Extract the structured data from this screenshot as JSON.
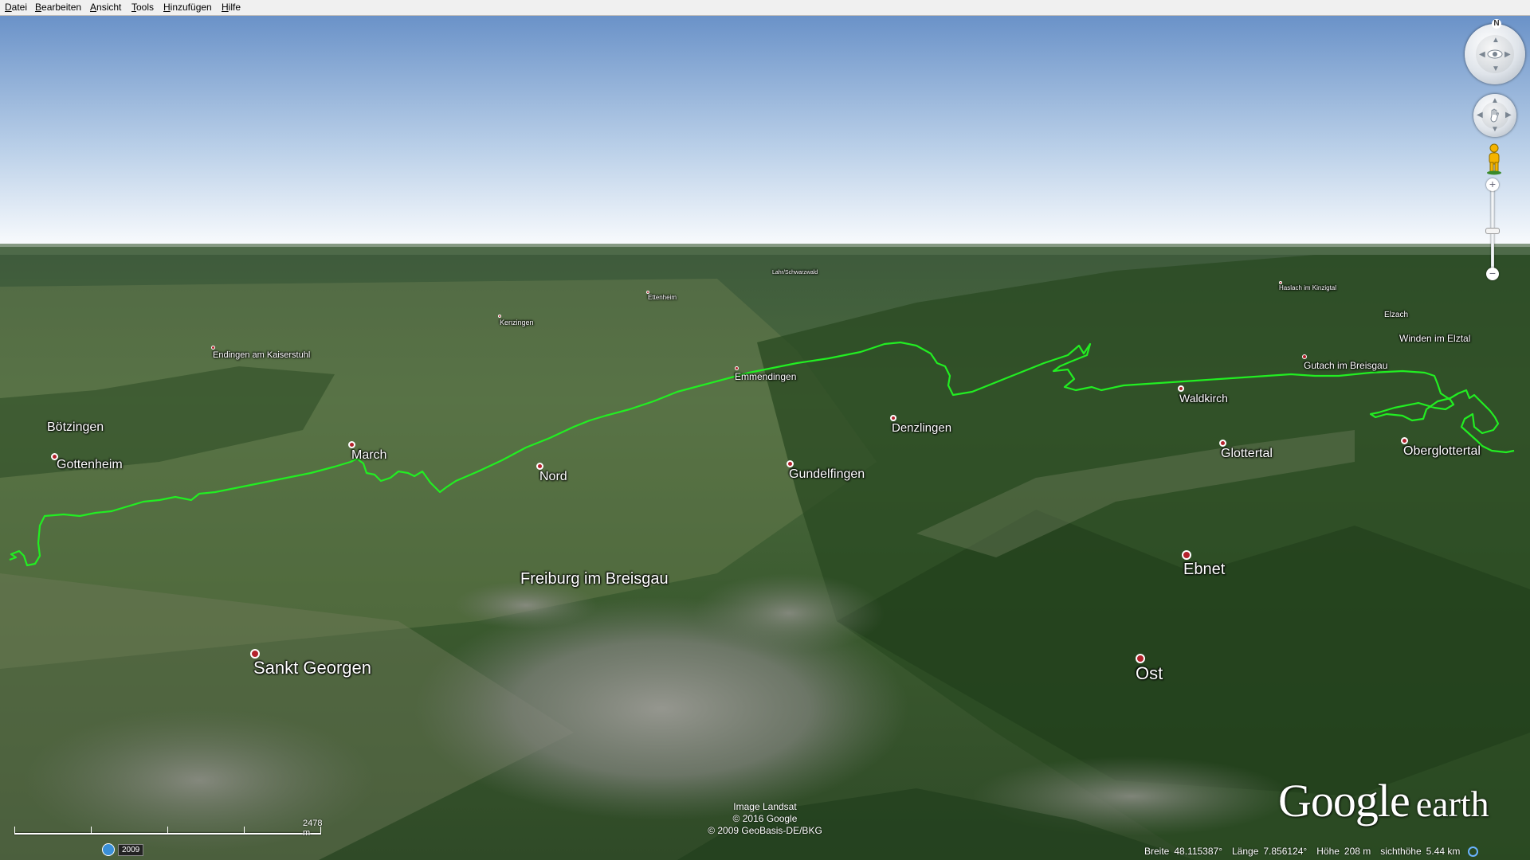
{
  "menu": {
    "items": [
      "Datei",
      "Bearbeiten",
      "Ansicht",
      "Tools",
      "Hinzufügen",
      "Hilfe"
    ]
  },
  "places": {
    "boetzingen": "Bötzingen",
    "gottenheim": "Gottenheim",
    "march": "March",
    "nord": "Nord",
    "gundelfingen": "Gundelfingen",
    "denzlingen": "Denzlingen",
    "waldkirch": "Waldkirch",
    "glottertal": "Glottertal",
    "oberglottertal": "Oberglottertal",
    "ebnet": "Ebnet",
    "freiburg": "Freiburg im Breisgau",
    "sankt_georgen": "Sankt Georgen",
    "ost": "Ost",
    "endingen": "Endingen am Kaiserstuhl",
    "kenzingen": "Kenzingen",
    "emmendingen": "Emmendingen",
    "ettenheim": "Ettenheim",
    "haslach": "Haslach im Kinzigtal",
    "elzach": "Elzach",
    "winden": "Winden im Elztal",
    "gutach": "Gutach im Breisgau",
    "schwanau": "Lahr/Schwarzwald"
  },
  "credits": {
    "line1": "Image Landsat",
    "line2": "© 2016 Google",
    "line3": "© 2009 GeoBasis-DE/BKG"
  },
  "logo": {
    "google": "Google",
    "earth": "earth"
  },
  "scale": {
    "label": "2478 m"
  },
  "history": {
    "year": "2009"
  },
  "status": {
    "lat_label": "Breite",
    "lat_value": "48.115387°",
    "lon_label": "Länge",
    "lon_value": "7.856124°",
    "alt_label": "Höhe",
    "alt_value": "208 m",
    "eye_label": "sichthöhe",
    "eye_value": "5.44 km"
  },
  "nav": {
    "north_label": "N"
  },
  "colors": {
    "track": "#22ee22",
    "marker": "#b3222c",
    "sky_top": "#6a92c8",
    "sky_bottom": "#ffffff"
  }
}
